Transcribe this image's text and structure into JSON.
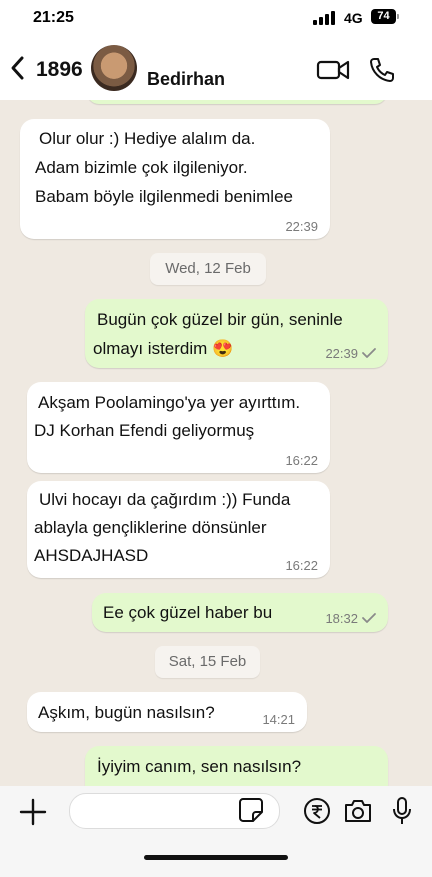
{
  "status_bar": {
    "time": "21:25",
    "network": "4G",
    "battery": "74"
  },
  "header": {
    "unread_count": "1896",
    "contact_name": "Bedirhan"
  },
  "messages": [
    {
      "dir": "in",
      "lines": [
        "Olur olur :) Hediye alalım da.",
        "Adam bizimle çok ilgileniyor.",
        "Babam böyle ilgilenmedi benimlee"
      ],
      "time": "22:39"
    },
    {
      "dir": "date",
      "label": "Wed, 12 Feb"
    },
    {
      "dir": "out",
      "lines": [
        "Bugün çok güzel bir gün, seninle",
        "olmayı isterdim 😍"
      ],
      "time": "22:39"
    },
    {
      "dir": "in",
      "lines": [
        "Akşam Poolamingo'ya yer ayırttım.",
        "DJ Korhan Efendi geliyormuş"
      ],
      "time": "16:22"
    },
    {
      "dir": "in",
      "lines": [
        "Ulvi hocayı da çağırdım :)) Funda",
        "ablayla gençliklerine dönsünler",
        "AHSDAJHASD"
      ],
      "time": "16:22"
    },
    {
      "dir": "out",
      "lines": [
        "Ee çok güzel haber bu"
      ],
      "time": "18:32"
    },
    {
      "dir": "date",
      "label": "Sat, 15 Feb"
    },
    {
      "dir": "in",
      "lines": [
        "Aşkım, bugün nasılsın?"
      ],
      "time": "14:21"
    },
    {
      "dir": "out",
      "lines": [
        "İyiyim canım, sen nasılsın?"
      ],
      "time": ""
    }
  ],
  "composer": {
    "placeholder": ""
  },
  "colors": {
    "incoming": "#ffffff",
    "outgoing": "#e3f9cd",
    "background": "#efe9e1",
    "tick": "#8a8a8a"
  },
  "icons": [
    "back-chevron-icon",
    "video-call-icon",
    "phone-icon",
    "plus-icon",
    "sticker-icon",
    "rupee-icon",
    "camera-icon",
    "mic-icon"
  ]
}
